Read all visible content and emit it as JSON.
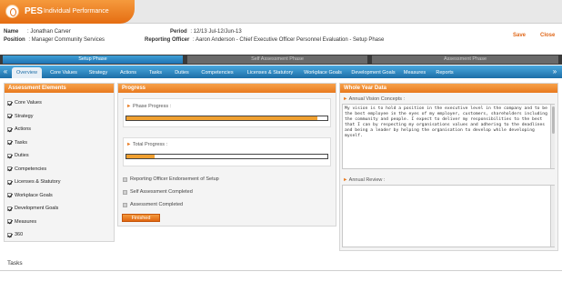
{
  "app": {
    "name": "PES",
    "subtitle": "Individual Performance"
  },
  "employee": {
    "name_label": "Name",
    "name_value": ": Jonathan Carver",
    "position_label": "Position",
    "position_value": ": Manager Community Services",
    "period_label": "Period",
    "period_value": ": 12/13 Jul-12/Jun-13",
    "officer_label": "Reporting Officer",
    "officer_value": ": Aaron Anderson - Chief Executive Officer Personnel Evaluation - Setup Phase"
  },
  "header_actions": {
    "save": "Save",
    "close": "Close"
  },
  "phases": [
    "Setup Phase",
    "Self Assessment Phase",
    "Assessment Phase"
  ],
  "tabs": [
    "Overview",
    "Core Values",
    "Strategy",
    "Actions",
    "Tasks",
    "Duties",
    "Competencies",
    "Licenses & Statutory",
    "Workplace Goals",
    "Development Goals",
    "Measures",
    "Reports"
  ],
  "nav": {
    "prev": "«",
    "next": "»"
  },
  "assessment": {
    "title": "Assessment Elements",
    "items": [
      {
        "label": "Core Values",
        "checked": true
      },
      {
        "label": "Strategy",
        "checked": true
      },
      {
        "label": "Actions",
        "checked": true
      },
      {
        "label": "Tasks",
        "checked": true
      },
      {
        "label": "Duties",
        "checked": true
      },
      {
        "label": "Competencies",
        "checked": true
      },
      {
        "label": "Licenses & Statutory",
        "checked": true
      },
      {
        "label": "Workplace Goals",
        "checked": true
      },
      {
        "label": "Development Goals",
        "checked": true
      },
      {
        "label": "Measures",
        "checked": true
      },
      {
        "label": "360",
        "checked": true
      }
    ]
  },
  "progress": {
    "title": "Progress",
    "phase_label": "Phase Progress :",
    "phase_value": 0.95,
    "total_label": "Total Progress :",
    "total_value": 0.14,
    "checks": [
      {
        "label": "Reporting Officer Endorsement of Setup",
        "checked": false
      },
      {
        "label": "Self Assessment Completed",
        "checked": false
      },
      {
        "label": "Assessment Completed",
        "checked": false
      }
    ],
    "finish_button": "Finished"
  },
  "whole_year": {
    "title": "Whole Year Data",
    "vision_label": "Annual Vision Concepts :",
    "vision_text": "My vision is to hold a position in the executive level in the company and to be the best employee in the eyes of my employer, customers, shareholders including the community and people. I expect to deliver my responsibilities to the best that I can by respecting my organisations values and adhering to the deadlines and being a leader by helping the organisation to develop while developing myself.",
    "review_label": "Annual Review :",
    "review_text": ""
  },
  "bottom": {
    "tasks_label": "Tasks"
  },
  "colors": {
    "accent_orange": "#e8791e",
    "nav_blue": "#1c6ea7",
    "phase_blue": "#2a86c4"
  }
}
